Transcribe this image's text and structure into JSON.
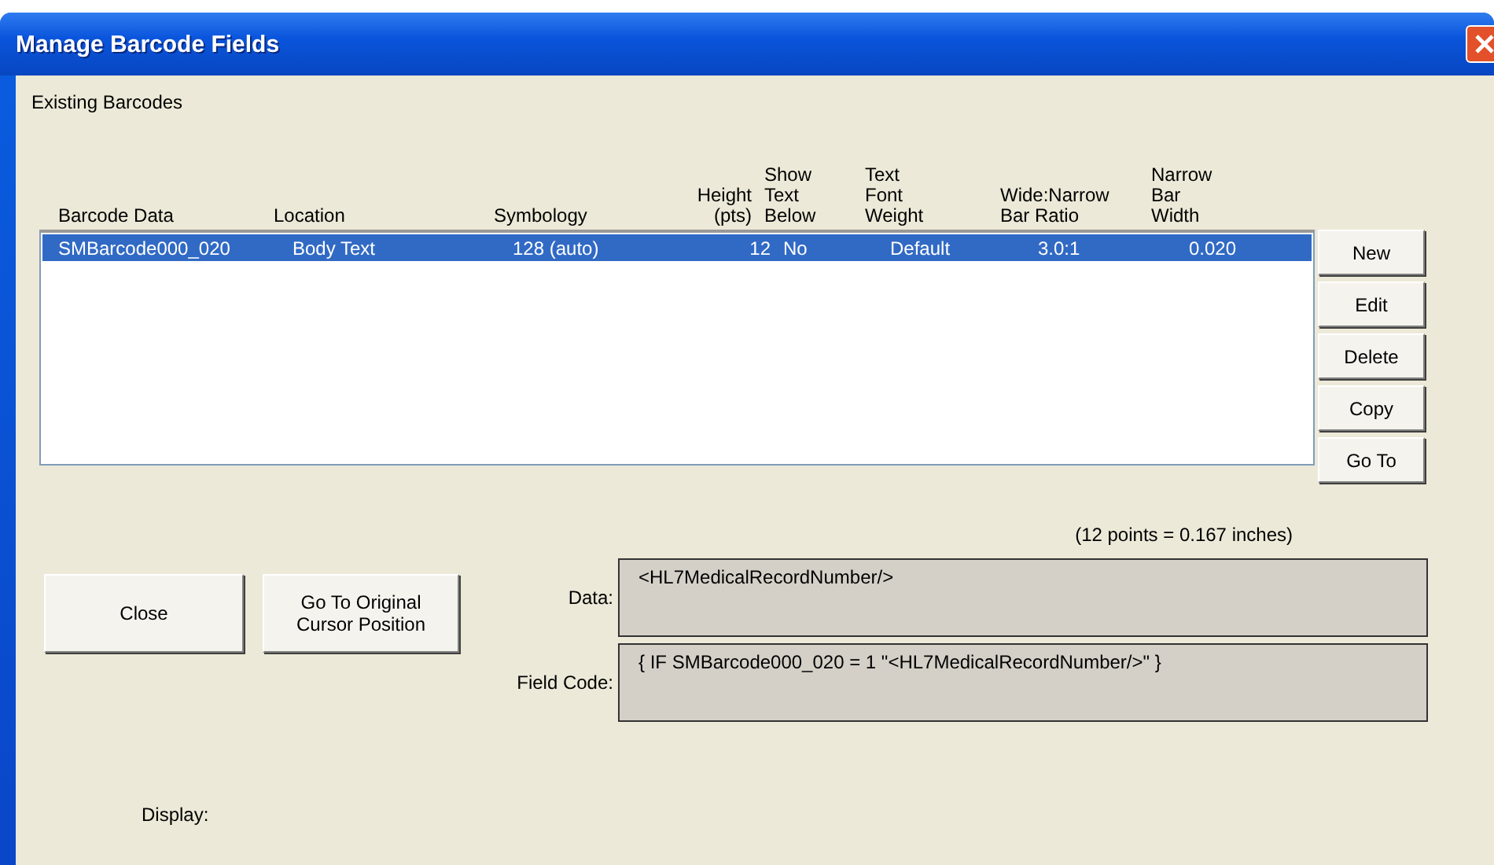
{
  "window": {
    "title": "Manage Barcode Fields"
  },
  "section_label": "Existing Barcodes",
  "table": {
    "columns": [
      "Barcode Data",
      "Location",
      "Symbology",
      "Height (pts)",
      "Show Text Below",
      "Text Font Weight",
      "Wide:Narrow Bar Ratio",
      "Narrow Bar Width"
    ],
    "rows": [
      {
        "selected": true,
        "cells": [
          "SMBarcode000_020",
          "Body Text",
          "128 (auto)",
          "12",
          "No",
          "Default",
          "3.0:1",
          "0.020"
        ]
      }
    ]
  },
  "side_buttons": [
    "New",
    "Edit",
    "Delete",
    "Copy",
    "Go To"
  ],
  "note": "(12 points = 0.167 inches)",
  "buttons": [
    "Close",
    "Go To Original Cursor Position"
  ],
  "fields": [
    {
      "label": "Data:",
      "value": "<HL7MedicalRecordNumber/>"
    },
    {
      "label": "Field Code:",
      "value": "{ IF SMBarcode000_020 = 1 \"<HL7MedicalRecordNumber/>\" }"
    }
  ],
  "display_label": "Display:"
}
